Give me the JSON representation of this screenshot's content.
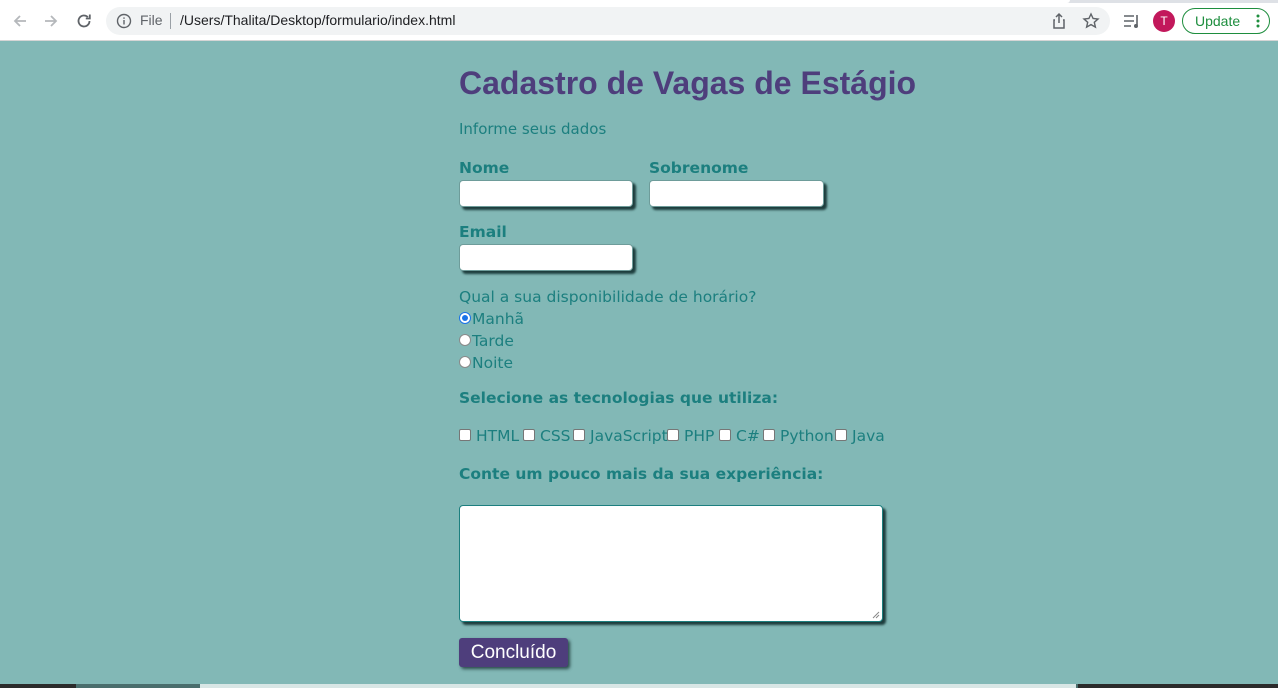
{
  "browser": {
    "scheme_label": "File",
    "url": "/Users/Thalita/Desktop/formulario/index.html",
    "avatar_letter": "T",
    "update_label": "Update",
    "avatar_color": "#c2185b",
    "update_color": "#1e8e3e"
  },
  "page": {
    "title": "Cadastro de Vagas de Estágio",
    "subtitle": "Informe seus dados",
    "fields": {
      "nome_label": "Nome",
      "nome_value": "",
      "sobrenome_label": "Sobrenome",
      "sobrenome_value": "",
      "email_label": "Email",
      "email_value": ""
    },
    "availability": {
      "question": "Qual a sua disponibilidade de horário?",
      "options": [
        {
          "label": "Manhã",
          "checked": true
        },
        {
          "label": "Tarde",
          "checked": false
        },
        {
          "label": "Noite",
          "checked": false
        }
      ]
    },
    "technologies": {
      "label": "Selecione as tecnologias que utiliza:",
      "options": [
        {
          "label": "HTML",
          "checked": false
        },
        {
          "label": "CSS",
          "checked": false
        },
        {
          "label": "JavaScript",
          "checked": false
        },
        {
          "label": "PHP",
          "checked": false
        },
        {
          "label": "C#",
          "checked": false
        },
        {
          "label": "Python",
          "checked": false
        },
        {
          "label": "Java",
          "checked": false
        }
      ]
    },
    "experience": {
      "label": "Conte um pouco mais da sua experiência:",
      "value": ""
    },
    "submit_label": "Concluído",
    "colors": {
      "background": "#82b8b6",
      "title": "#4e3e7c",
      "text": "#1c7f7f",
      "button": "#4e3e7c"
    }
  }
}
